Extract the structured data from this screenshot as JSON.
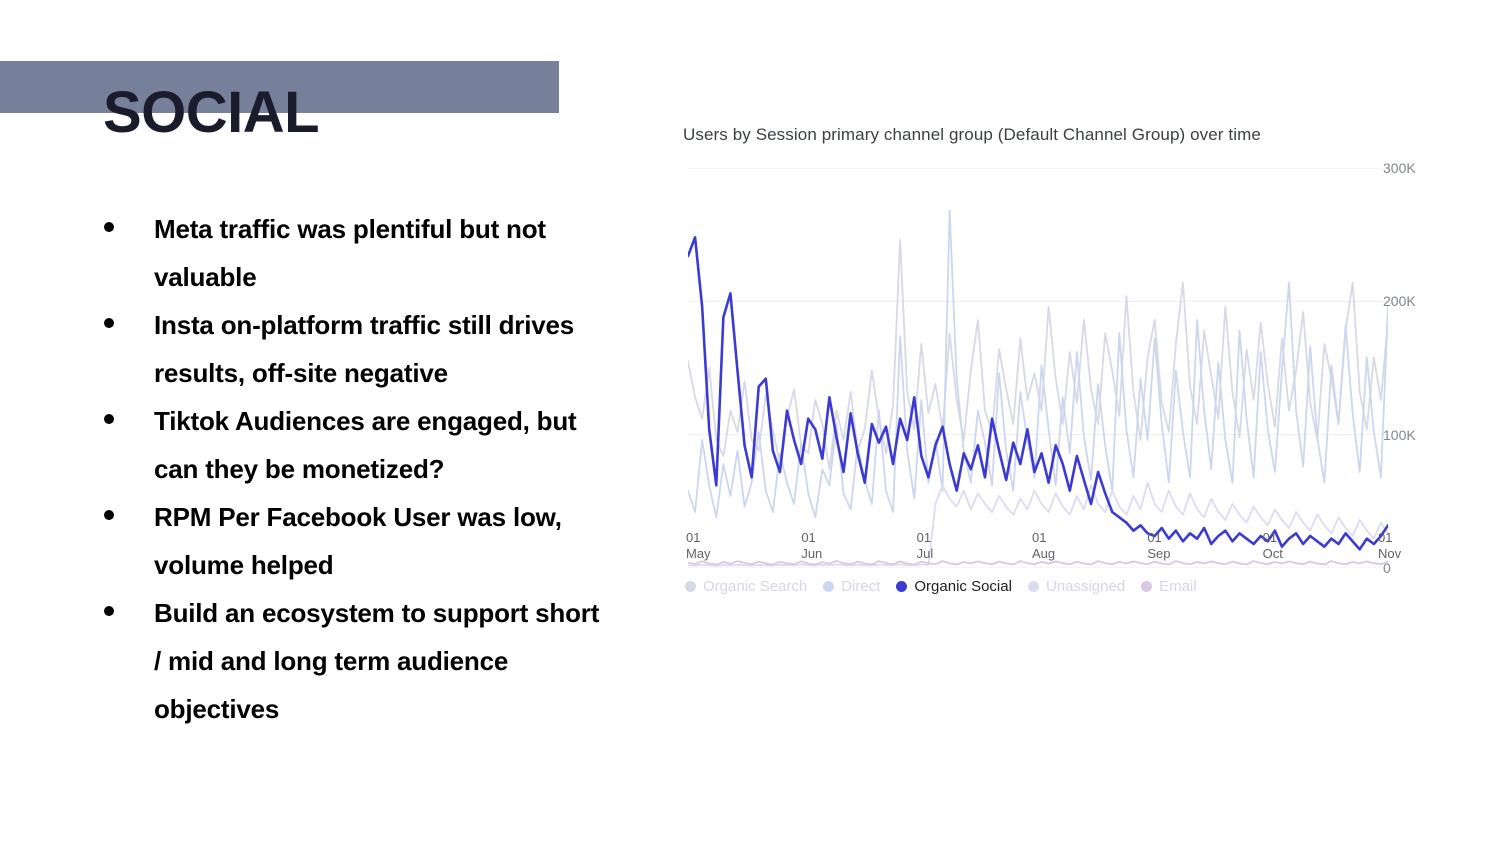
{
  "slide": {
    "title": "SOCIAL",
    "banner_color": "#76809a",
    "title_color": "#1a1c2c",
    "background": "#ffffff"
  },
  "bullets": [
    {
      "text": "Meta traffic was plentiful but not valuable"
    },
    {
      "text": "Insta on-platform traffic still drives results, off-site negative"
    },
    {
      "text": "Tiktok Audiences are engaged, but can they be monetized?"
    },
    {
      "text": "RPM Per Facebook User was low, volume helped"
    },
    {
      "text": "Build an ecosystem to support short / mid and long term audience objectives"
    }
  ],
  "chart_data": {
    "type": "line",
    "title": "Users by Session primary channel group (Default Channel Group) over time",
    "xlabel": "",
    "ylabel": "",
    "ylim": [
      0,
      300000
    ],
    "yticks": [
      "0",
      "100K",
      "200K",
      "300K"
    ],
    "ytick_values": [
      0,
      100000,
      200000,
      300000
    ],
    "grid": true,
    "legend_position": "bottom",
    "x": [
      "01 May",
      "01 Jun",
      "01 Jul",
      "01 Aug",
      "01 Sep",
      "01 Oct",
      "01 Nov"
    ],
    "xtick_days": [
      "01",
      "01",
      "01",
      "01",
      "01",
      "01",
      "01"
    ],
    "xtick_months": [
      "May",
      "Jun",
      "Jul",
      "Aug",
      "Sep",
      "Oct",
      "Nov"
    ],
    "series": [
      {
        "name": "Organic Search",
        "color": "#d7d9e4",
        "highlighted": false,
        "values": [
          155000,
          128000,
          112000,
          150000,
          96000,
          84000,
          118000,
          102000,
          140000,
          96000,
          88000,
          130000,
          104000,
          78000,
          112000,
          134000,
          92000,
          86000,
          126000,
          108000,
          74000,
          118000,
          96000,
          132000,
          88000,
          104000,
          148000,
          112000,
          86000,
          122000,
          246000,
          132000,
          104000,
          168000,
          116000,
          138000,
          104000,
          176000,
          126000,
          96000,
          148000,
          186000,
          118000,
          102000,
          164000,
          134000,
          108000,
          172000,
          126000,
          146000,
          118000,
          196000,
          142000,
          108000,
          162000,
          124000,
          186000,
          134000,
          108000,
          176000,
          148000,
          114000,
          204000,
          132000,
          96000,
          158000,
          186000,
          124000,
          102000,
          168000,
          214000,
          136000,
          108000,
          178000,
          144000,
          112000,
          196000,
          132000,
          98000,
          164000,
          126000,
          184000,
          138000,
          106000,
          172000,
          118000,
          148000,
          192000,
          124000,
          96000,
          168000,
          142000,
          108000,
          178000,
          214000,
          132000,
          104000,
          158000,
          126000,
          186000
        ]
      },
      {
        "name": "Direct",
        "color": "#cdd6ef",
        "highlighted": false,
        "values": [
          58000,
          42000,
          96000,
          62000,
          38000,
          78000,
          54000,
          88000,
          46000,
          64000,
          102000,
          58000,
          42000,
          86000,
          64000,
          48000,
          94000,
          56000,
          38000,
          74000,
          62000,
          108000,
          56000,
          44000,
          92000,
          66000,
          48000,
          118000,
          58000,
          42000,
          174000,
          88000,
          52000,
          126000,
          64000,
          96000,
          58000,
          268000,
          142000,
          88000,
          64000,
          118000,
          94000,
          62000,
          146000,
          88000,
          58000,
          132000,
          96000,
          68000,
          152000,
          104000,
          62000,
          128000,
          86000,
          162000,
          98000,
          66000,
          138000,
          92000,
          58000,
          176000,
          104000,
          68000,
          142000,
          96000,
          172000,
          108000,
          64000,
          148000,
          102000,
          68000,
          186000,
          118000,
          74000,
          154000,
          96000,
          64000,
          178000,
          112000,
          68000,
          162000,
          104000,
          72000,
          148000,
          214000,
          118000,
          76000,
          166000,
          98000,
          64000,
          152000,
          108000,
          182000,
          116000,
          72000,
          158000,
          102000,
          68000,
          196000
        ]
      },
      {
        "name": "Organic Social",
        "color": "#3b3bd4",
        "highlighted": true,
        "values": [
          234000,
          248000,
          196000,
          104000,
          62000,
          188000,
          206000,
          148000,
          92000,
          68000,
          136000,
          142000,
          88000,
          72000,
          118000,
          96000,
          78000,
          112000,
          104000,
          82000,
          128000,
          98000,
          72000,
          116000,
          86000,
          64000,
          108000,
          94000,
          106000,
          78000,
          112000,
          96000,
          128000,
          84000,
          68000,
          92000,
          106000,
          78000,
          58000,
          86000,
          74000,
          92000,
          68000,
          112000,
          88000,
          66000,
          94000,
          78000,
          104000,
          72000,
          86000,
          64000,
          92000,
          78000,
          58000,
          84000,
          66000,
          48000,
          72000,
          56000,
          42000,
          38000,
          34000,
          28000,
          32000,
          26000,
          24000,
          30000,
          22000,
          28000,
          20000,
          26000,
          22000,
          30000,
          18000,
          24000,
          28000,
          20000,
          26000,
          22000,
          18000,
          24000,
          20000,
          28000,
          16000,
          22000,
          26000,
          18000,
          24000,
          20000,
          16000,
          22000,
          18000,
          26000,
          20000,
          14000,
          22000,
          18000,
          24000,
          32000
        ]
      },
      {
        "name": "Unassigned",
        "color": "#dcdcf0",
        "highlighted": false,
        "values": [
          2000,
          1800,
          2400,
          2000,
          1600,
          2200,
          1900,
          2500,
          2100,
          1700,
          2300,
          2000,
          1800,
          2400,
          2200,
          1900,
          2600,
          2100,
          1800,
          2400,
          2000,
          2700,
          2200,
          1900,
          2500,
          2100,
          1800,
          2600,
          2200,
          2000,
          2800,
          2300,
          2000,
          2600,
          2200,
          48000,
          62000,
          52000,
          46000,
          58000,
          44000,
          56000,
          48000,
          42000,
          54000,
          46000,
          40000,
          52000,
          44000,
          58000,
          48000,
          42000,
          56000,
          46000,
          40000,
          54000,
          44000,
          62000,
          48000,
          42000,
          58000,
          46000,
          40000,
          54000,
          44000,
          64000,
          48000,
          42000,
          58000,
          46000,
          40000,
          56000,
          44000,
          38000,
          52000,
          42000,
          36000,
          48000,
          40000,
          34000,
          46000,
          38000,
          32000,
          44000,
          36000,
          30000,
          42000,
          34000,
          28000,
          40000,
          32000,
          26000,
          38000,
          30000,
          24000,
          36000,
          28000,
          22000,
          34000,
          26000
        ]
      },
      {
        "name": "Email",
        "color": "#d9c7e4",
        "highlighted": false,
        "values": [
          4000,
          3000,
          5000,
          3500,
          2500,
          4500,
          3000,
          5200,
          3800,
          2800,
          4800,
          3400,
          2600,
          4600,
          3600,
          2800,
          5000,
          3400,
          2600,
          4400,
          3200,
          5400,
          3600,
          2800,
          4800,
          3400,
          2600,
          5200,
          3600,
          2800,
          5000,
          3400,
          2600,
          4800,
          3600,
          2800,
          5200,
          3400,
          2600,
          4600,
          3400,
          5000,
          3600,
          2800,
          4800,
          3400,
          2600,
          5200,
          3600,
          2800,
          4600,
          3400,
          5000,
          3600,
          2800,
          4800,
          3400,
          2600,
          5200,
          3600,
          2800,
          4600,
          3400,
          5000,
          3600,
          2800,
          4800,
          3400,
          2600,
          5200,
          3600,
          2800,
          4600,
          3400,
          5000,
          3600,
          2800,
          4800,
          3400,
          2600,
          5200,
          3600,
          2800,
          4600,
          3400,
          5000,
          3600,
          2800,
          4800,
          3400,
          2600,
          5200,
          3600,
          2800,
          4600,
          3400,
          5000,
          3600,
          2800,
          4800
        ]
      }
    ]
  }
}
